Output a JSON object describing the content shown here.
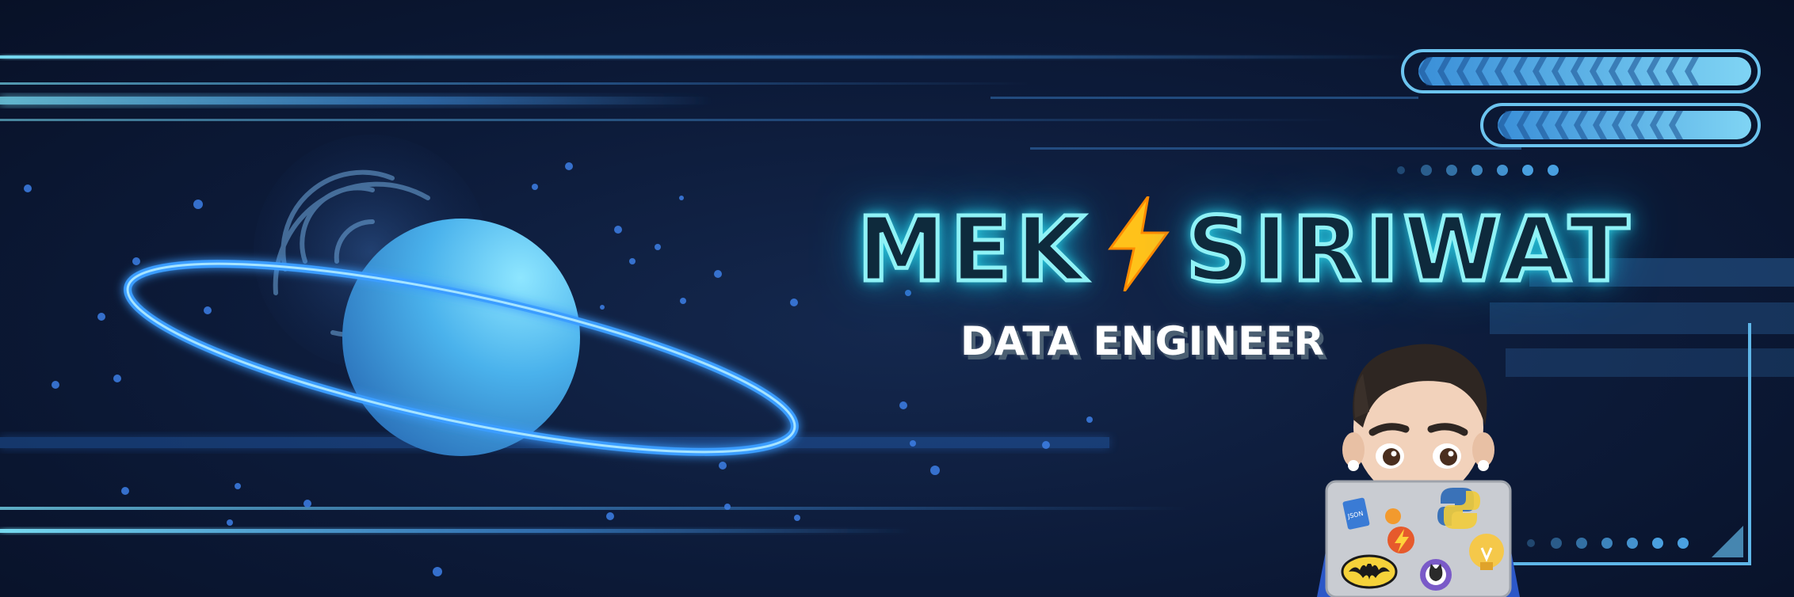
{
  "banner": {
    "name_first": "MEK",
    "name_last": "SIRIWAT",
    "role": "DATA ENGINEER"
  },
  "stickers": {
    "json_label": "JSON"
  },
  "colors": {
    "background": "#0c1a38",
    "neon_cyan": "#8ff2f6",
    "accent_blue": "#3aa0ff",
    "bolt_yellow": "#ffc21a"
  },
  "icons": [
    "planet-icon",
    "lightning-bolt-icon",
    "memoji-avatar",
    "laptop-icon",
    "python-sticker-icon",
    "github-sticker-icon",
    "batman-sticker-icon",
    "lightbulb-sticker-icon",
    "json-sticker-icon",
    "chevron-progress-icon"
  ]
}
